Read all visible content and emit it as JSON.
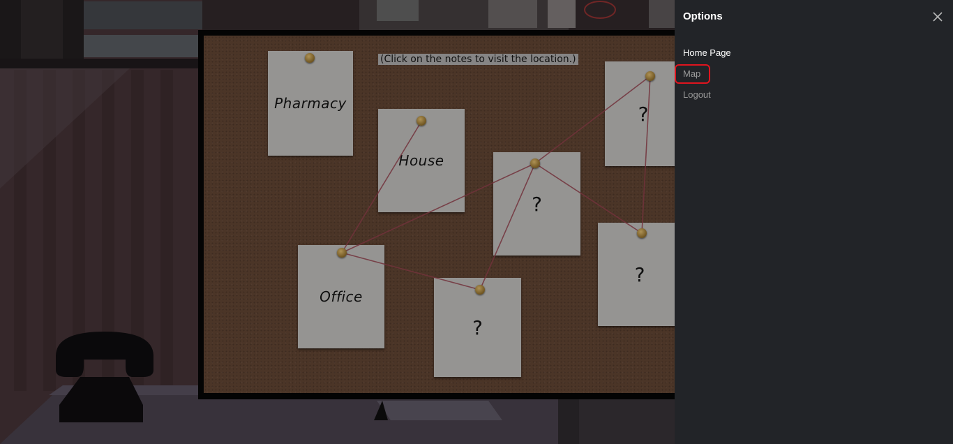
{
  "scene": {
    "hint": "(Click on the notes to visit the location.)",
    "notes": [
      {
        "label": "Pharmacy"
      },
      {
        "label": "House"
      },
      {
        "label": "Office"
      },
      {
        "label": "?"
      },
      {
        "label": "?"
      },
      {
        "label": "?"
      },
      {
        "label": "?"
      }
    ]
  },
  "drawer": {
    "title": "Options",
    "menu": [
      "Home Page",
      "Map",
      "Logout"
    ],
    "highlighted_item": "Map"
  },
  "colors": {
    "drawer_bg": "#222428",
    "highlight": "#e0141e",
    "cork": "#5e4231"
  }
}
